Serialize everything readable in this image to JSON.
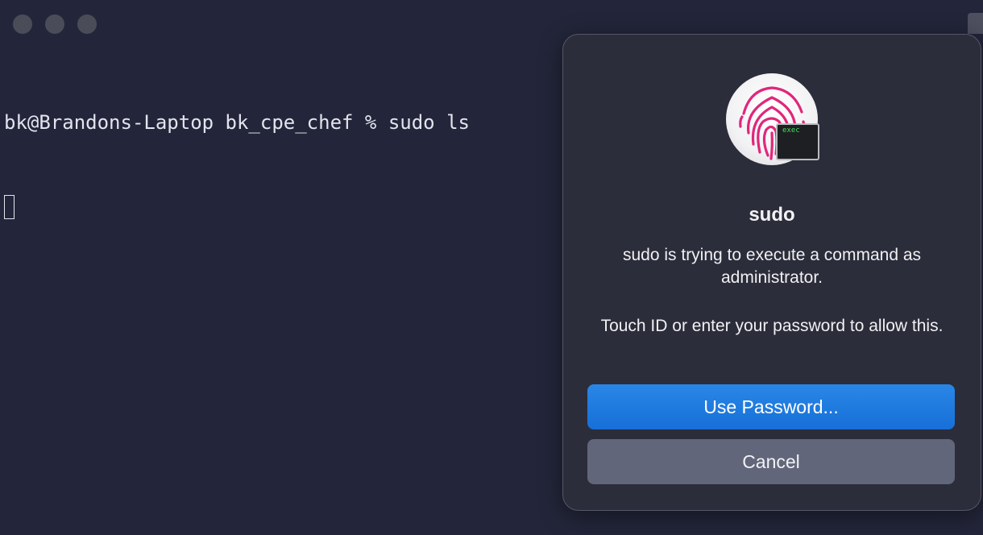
{
  "terminal": {
    "prompt_line": "bk@Brandons-Laptop bk_cpe_chef % sudo ls"
  },
  "dialog": {
    "title": "sudo",
    "message_1": "sudo is trying to execute a command as administrator.",
    "message_2": "Touch ID or enter your password to allow this.",
    "badge_text": "exec",
    "primary_button": "Use Password...",
    "secondary_button": "Cancel",
    "icon": "fingerprint-icon"
  },
  "colors": {
    "terminal_bg": "#23263a",
    "accent": "#1670d8",
    "fingerprint": "#e0277a"
  }
}
